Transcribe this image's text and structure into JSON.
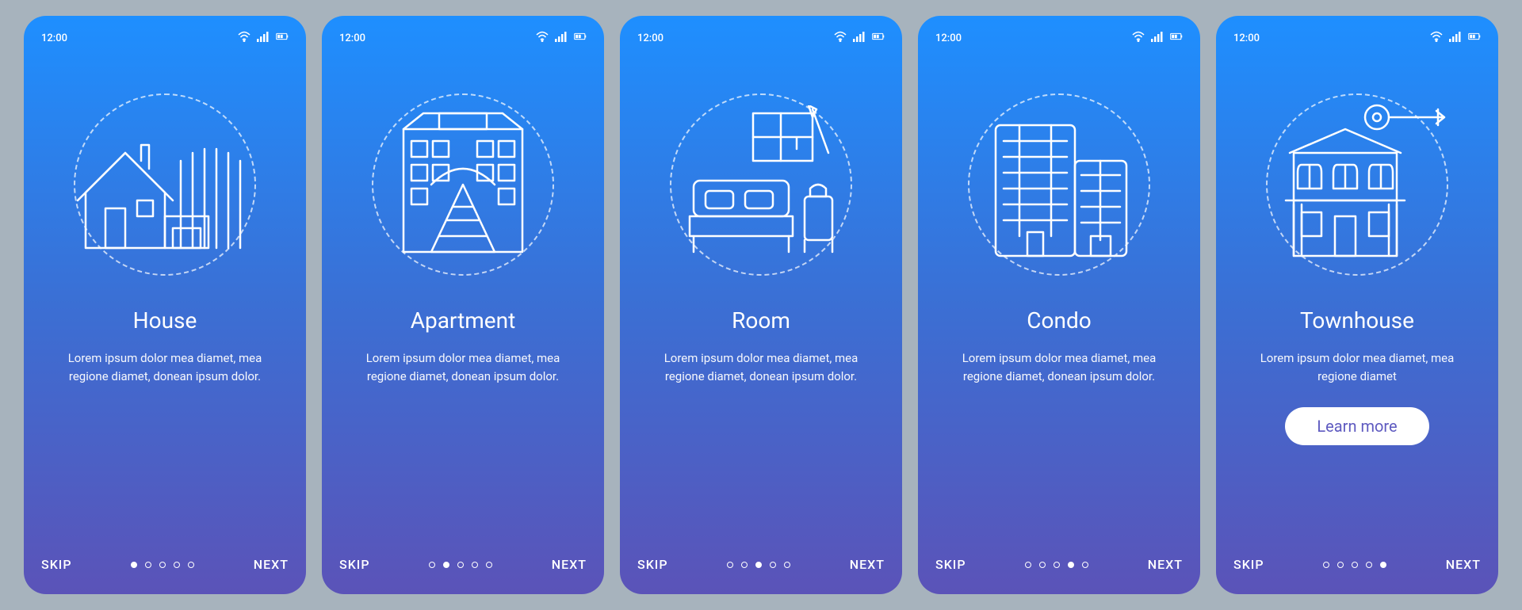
{
  "status_time": "12:00",
  "skip_label": "SKIP",
  "next_label": "NEXT",
  "learn_more_label": "Learn more",
  "lorem": "Lorem ipsum dolor mea diamet, mea regione diamet, donean ipsum dolor.",
  "lorem_short": "Lorem ipsum dolor mea diamet, mea regione diamet",
  "screens": [
    {
      "title": "House",
      "active": 0
    },
    {
      "title": "Apartment",
      "active": 1
    },
    {
      "title": "Room",
      "active": 2
    },
    {
      "title": "Condo",
      "active": 3
    },
    {
      "title": "Townhouse",
      "active": 4
    }
  ]
}
